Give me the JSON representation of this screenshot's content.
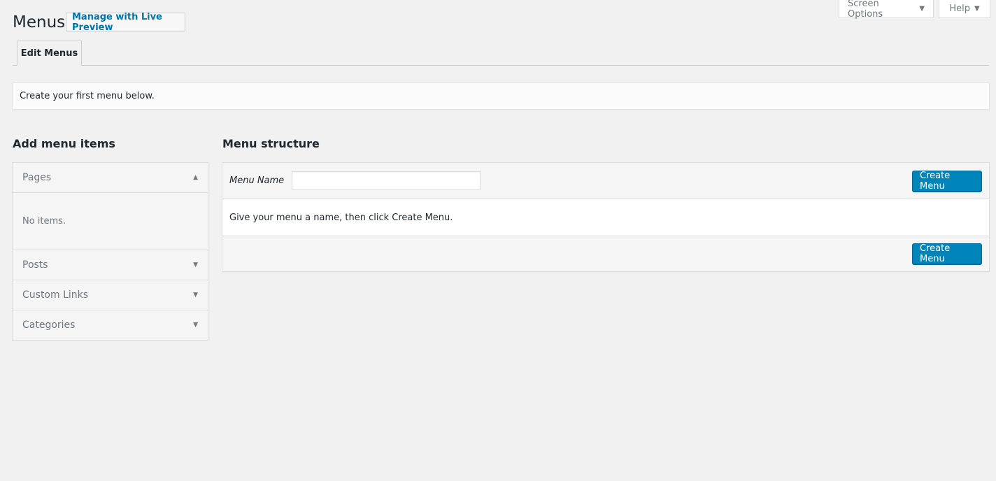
{
  "header": {
    "title": "Menus",
    "live_preview_label": "Manage with Live Preview",
    "screen_options_label": "Screen Options",
    "help_label": "Help"
  },
  "tabs": [
    {
      "label": "Edit Menus",
      "active": true
    }
  ],
  "notice": {
    "text": "Create your first menu below."
  },
  "add_menu_items": {
    "heading": "Add menu items",
    "sections": [
      {
        "label": "Pages",
        "expanded": true,
        "body": "No items."
      },
      {
        "label": "Posts",
        "expanded": false
      },
      {
        "label": "Custom Links",
        "expanded": false
      },
      {
        "label": "Categories",
        "expanded": false
      }
    ]
  },
  "menu_structure": {
    "heading": "Menu structure",
    "menu_name_label": "Menu Name",
    "menu_name_value": "",
    "instructions": "Give your menu a name, then click Create Menu.",
    "create_button_label": "Create Menu"
  },
  "colors": {
    "background": "#f1f1f1",
    "primary_button": "#0085ba",
    "link": "#0073aa"
  }
}
